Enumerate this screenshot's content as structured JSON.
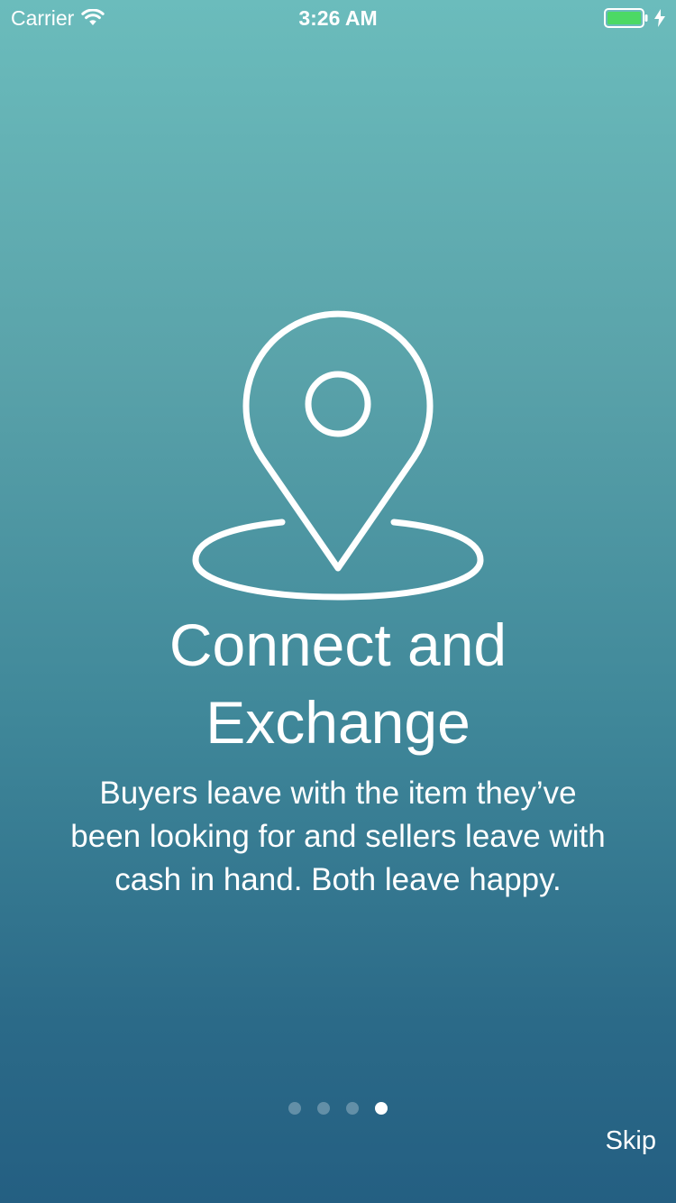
{
  "status_bar": {
    "carrier": "Carrier",
    "time": "3:26 AM",
    "icons": [
      "wifi-icon",
      "battery-icon",
      "charging-icon"
    ],
    "battery_color": "#4cd964"
  },
  "onboarding": {
    "icon": "location-pin-icon",
    "title_lines": [
      "Connect and",
      "Exchange"
    ],
    "description": "Buyers leave with the item they’ve been looking for and sellers leave with cash in hand. Both leave happy."
  },
  "pagination": {
    "total_pages": 4,
    "current_page": 4
  },
  "skip_label": "Skip"
}
